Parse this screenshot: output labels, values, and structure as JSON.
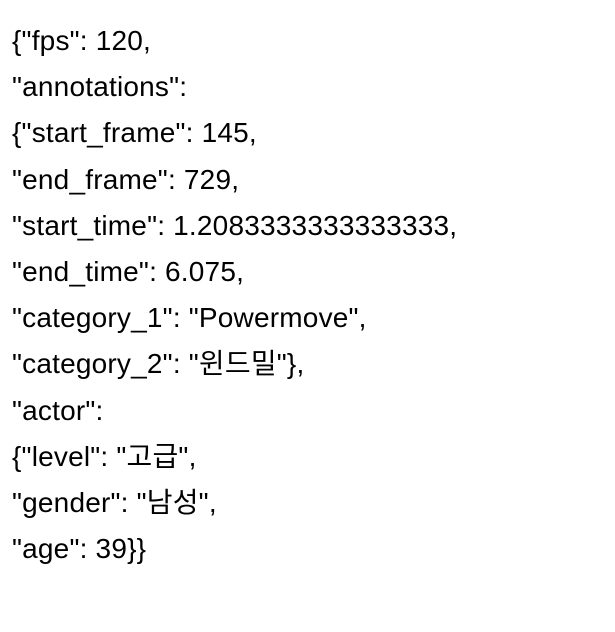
{
  "lines": {
    "l0": "{\"fps\": 120,",
    "l1": "\"annotations\":",
    "l2": "{\"start_frame\": 145,",
    "l3": "\"end_frame\": 729,",
    "l4": "\"start_time\": 1.2083333333333333,",
    "l5": "\"end_time\": 6.075,",
    "l6": "\"category_1\": \"Powermove\",",
    "l7": "\"category_2\": \"윈드밀\"},",
    "l8": "\"actor\":",
    "l9": "{\"level\": \"고급\",",
    "l10": "\"gender\": \"남성\",",
    "l11": "\"age\": 39}}"
  }
}
